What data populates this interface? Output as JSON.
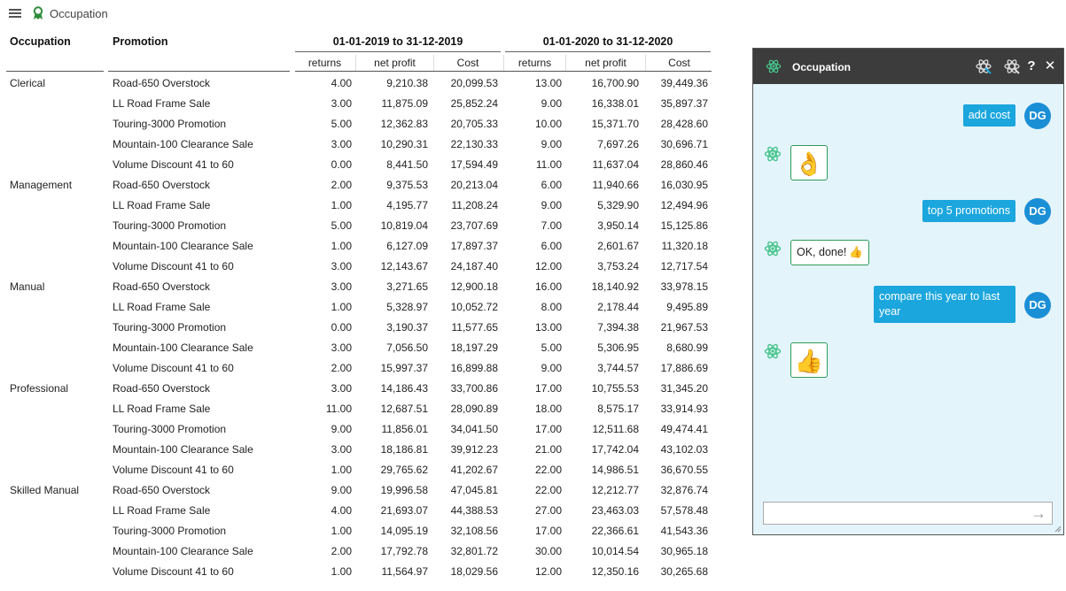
{
  "app": {
    "title": "Occupation",
    "menu_icon": "hamburger-icon",
    "app_icon": "ribbon-award-icon"
  },
  "report": {
    "headers": {
      "occupation": "Occupation",
      "promotion": "Promotion",
      "periods": [
        "01-01-2019 to 31-12-2019",
        "01-01-2020 to 31-12-2020"
      ],
      "measures": [
        "returns",
        "net profit",
        "Cost"
      ]
    },
    "rows": [
      {
        "occupation": "Clerical",
        "promotion": "Road-650 Overstock",
        "values": [
          "4.00",
          "9,210.38",
          "20,099.53",
          "13.00",
          "16,700.90",
          "39,449.36"
        ]
      },
      {
        "occupation": "",
        "promotion": "LL Road Frame Sale",
        "values": [
          "3.00",
          "11,875.09",
          "25,852.24",
          "9.00",
          "16,338.01",
          "35,897.37"
        ]
      },
      {
        "occupation": "",
        "promotion": "Touring-3000 Promotion",
        "values": [
          "5.00",
          "12,362.83",
          "20,705.33",
          "10.00",
          "15,371.70",
          "28,428.60"
        ]
      },
      {
        "occupation": "",
        "promotion": "Mountain-100 Clearance Sale",
        "values": [
          "3.00",
          "10,290.31",
          "22,130.33",
          "9.00",
          "7,697.26",
          "30,696.71"
        ]
      },
      {
        "occupation": "",
        "promotion": "Volume Discount 41 to 60",
        "values": [
          "0.00",
          "8,441.50",
          "17,594.49",
          "11.00",
          "11,637.04",
          "28,860.46"
        ]
      },
      {
        "occupation": "Management",
        "promotion": "Road-650 Overstock",
        "values": [
          "2.00",
          "9,375.53",
          "20,213.04",
          "6.00",
          "11,940.66",
          "16,030.95"
        ]
      },
      {
        "occupation": "",
        "promotion": "LL Road Frame Sale",
        "values": [
          "1.00",
          "4,195.77",
          "11,208.24",
          "9.00",
          "5,329.90",
          "12,494.96"
        ]
      },
      {
        "occupation": "",
        "promotion": "Touring-3000 Promotion",
        "values": [
          "5.00",
          "10,819.04",
          "23,707.69",
          "7.00",
          "3,950.14",
          "15,125.86"
        ]
      },
      {
        "occupation": "",
        "promotion": "Mountain-100 Clearance Sale",
        "values": [
          "1.00",
          "6,127.09",
          "17,897.37",
          "6.00",
          "2,601.67",
          "11,320.18"
        ]
      },
      {
        "occupation": "",
        "promotion": "Volume Discount 41 to 60",
        "values": [
          "3.00",
          "12,143.67",
          "24,187.40",
          "12.00",
          "3,753.24",
          "12,717.54"
        ]
      },
      {
        "occupation": "Manual",
        "promotion": "Road-650 Overstock",
        "values": [
          "3.00",
          "3,271.65",
          "12,900.18",
          "16.00",
          "18,140.92",
          "33,978.15"
        ]
      },
      {
        "occupation": "",
        "promotion": "LL Road Frame Sale",
        "values": [
          "1.00",
          "5,328.97",
          "10,052.72",
          "8.00",
          "2,178.44",
          "9,495.89"
        ]
      },
      {
        "occupation": "",
        "promotion": "Touring-3000 Promotion",
        "values": [
          "0.00",
          "3,190.37",
          "11,577.65",
          "13.00",
          "7,394.38",
          "21,967.53"
        ]
      },
      {
        "occupation": "",
        "promotion": "Mountain-100 Clearance Sale",
        "values": [
          "3.00",
          "7,056.50",
          "18,197.29",
          "5.00",
          "5,306.95",
          "8,680.99"
        ]
      },
      {
        "occupation": "",
        "promotion": "Volume Discount 41 to 60",
        "values": [
          "2.00",
          "15,997.37",
          "16,899.88",
          "9.00",
          "3,744.57",
          "17,886.69"
        ]
      },
      {
        "occupation": "Professional",
        "promotion": "Road-650 Overstock",
        "values": [
          "3.00",
          "14,186.43",
          "33,700.86",
          "17.00",
          "10,755.53",
          "31,345.20"
        ]
      },
      {
        "occupation": "",
        "promotion": "LL Road Frame Sale",
        "values": [
          "11.00",
          "12,687.51",
          "28,090.89",
          "18.00",
          "8,575.17",
          "33,914.93"
        ]
      },
      {
        "occupation": "",
        "promotion": "Touring-3000 Promotion",
        "values": [
          "9.00",
          "11,856.01",
          "34,041.50",
          "17.00",
          "12,511.68",
          "49,474.41"
        ]
      },
      {
        "occupation": "",
        "promotion": "Mountain-100 Clearance Sale",
        "values": [
          "3.00",
          "18,186.81",
          "39,912.23",
          "21.00",
          "17,742.04",
          "43,102.03"
        ]
      },
      {
        "occupation": "",
        "promotion": "Volume Discount 41 to 60",
        "values": [
          "1.00",
          "29,765.62",
          "41,202.67",
          "22.00",
          "14,986.51",
          "36,670.55"
        ]
      },
      {
        "occupation": "Skilled Manual",
        "promotion": "Road-650 Overstock",
        "values": [
          "9.00",
          "19,996.58",
          "47,045.81",
          "22.00",
          "12,212.77",
          "32,876.74"
        ]
      },
      {
        "occupation": "",
        "promotion": "LL Road Frame Sale",
        "values": [
          "4.00",
          "21,693.07",
          "44,388.53",
          "27.00",
          "23,463.03",
          "57,578.48"
        ]
      },
      {
        "occupation": "",
        "promotion": "Touring-3000 Promotion",
        "values": [
          "1.00",
          "14,095.19",
          "32,108.56",
          "17.00",
          "22,366.61",
          "41,543.36"
        ]
      },
      {
        "occupation": "",
        "promotion": "Mountain-100 Clearance Sale",
        "values": [
          "2.00",
          "17,792.78",
          "32,801.72",
          "30.00",
          "10,014.54",
          "30,965.18"
        ]
      },
      {
        "occupation": "",
        "promotion": "Volume Discount 41 to 60",
        "values": [
          "1.00",
          "11,564.97",
          "18,029.56",
          "12.00",
          "12,350.16",
          "30,265.68"
        ]
      }
    ]
  },
  "chat": {
    "title": "Occupation",
    "controls": {
      "help": "?",
      "close": "✕"
    },
    "user_initials": "DG",
    "messages": [
      {
        "from": "user",
        "text": "add cost"
      },
      {
        "from": "bot",
        "emoji": "👌"
      },
      {
        "from": "user",
        "text": "top 5 promotions"
      },
      {
        "from": "bot",
        "text": "OK, done!",
        "emoji": "👍"
      },
      {
        "from": "user",
        "text": "compare this year to last year"
      },
      {
        "from": "bot",
        "emoji": "👍"
      }
    ],
    "input": {
      "value": "",
      "placeholder": ""
    },
    "send_icon": "arrow-right-icon"
  },
  "colors": {
    "accent_blue": "#1ba6dd",
    "avatar_blue": "#1b8fd6",
    "chat_bg": "#e4f4fb",
    "title_bar": "#3c3c3c",
    "bot_border": "#2e9a5a"
  }
}
